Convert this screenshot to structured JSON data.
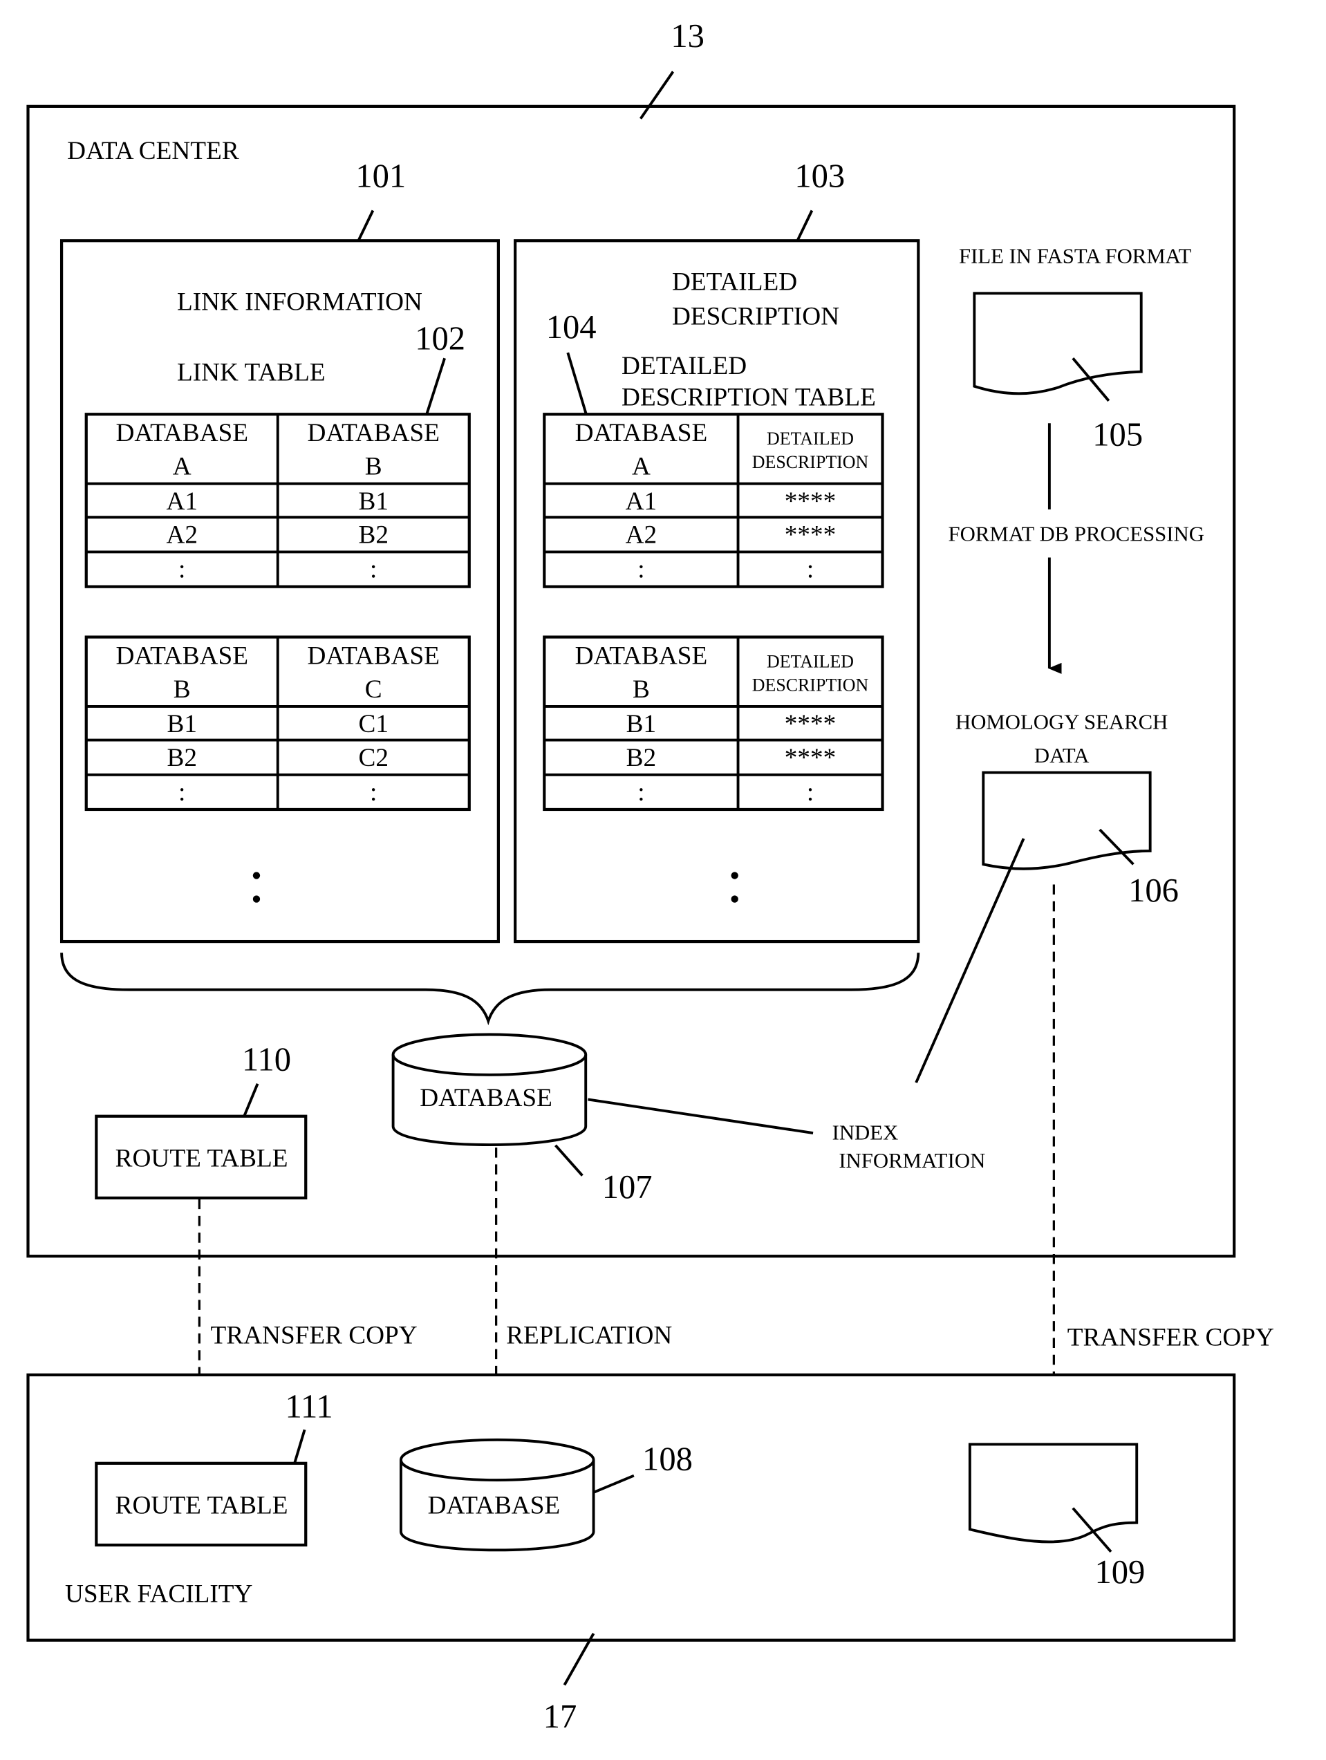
{
  "figure": {
    "refs": {
      "data_center": "13",
      "user_facility": "17",
      "link_information": "101",
      "link_table": "102",
      "detailed_description": "103",
      "detailed_description_table": "104",
      "fasta_file": "105",
      "homology_search_data": "106",
      "database_center": "107",
      "database_user": "108",
      "homology_copy": "109",
      "route_table_center": "110",
      "route_table_user": "111"
    },
    "data_center": {
      "title": "DATA CENTER",
      "link_information": {
        "title": "LINK INFORMATION",
        "subtitle": "LINK TABLE",
        "tables": [
          {
            "headers": [
              [
                "DATABASE",
                "A"
              ],
              [
                "DATABASE",
                "B"
              ]
            ],
            "rows": [
              [
                "A1",
                "B1"
              ],
              [
                "A2",
                "B2"
              ],
              [
                ":",
                ":"
              ]
            ]
          },
          {
            "headers": [
              [
                "DATABASE",
                "B"
              ],
              [
                "DATABASE",
                "C"
              ]
            ],
            "rows": [
              [
                "B1",
                "C1"
              ],
              [
                "B2",
                "C2"
              ],
              [
                ":",
                ":"
              ]
            ]
          }
        ],
        "ellipsis": ":"
      },
      "detailed_description": {
        "title_line1": "DETAILED",
        "title_line2": "DESCRIPTION",
        "subtitle_line1": "DETAILED",
        "subtitle_line2": "DESCRIPTION TABLE",
        "tables": [
          {
            "headers": [
              [
                "DATABASE",
                "A"
              ],
              [
                "DETAILED",
                "DESCRIPTION"
              ]
            ],
            "rows": [
              [
                "A1",
                "****"
              ],
              [
                "A2",
                "****"
              ],
              [
                ":",
                ":"
              ]
            ]
          },
          {
            "headers": [
              [
                "DATABASE",
                "B"
              ],
              [
                "DETAILED",
                "DESCRIPTION"
              ]
            ],
            "rows": [
              [
                "B1",
                "****"
              ],
              [
                "B2",
                "****"
              ],
              [
                ":",
                ":"
              ]
            ]
          }
        ],
        "ellipsis": ":"
      },
      "fasta_label": "FILE IN FASTA FORMAT",
      "format_processing_label": "FORMAT DB PROCESSING",
      "homology_label_line1": "HOMOLOGY SEARCH",
      "homology_label_line2": "DATA",
      "database_label": "DATABASE",
      "index_label_line1": "INDEX",
      "index_label_line2": "INFORMATION",
      "route_table_label": "ROUTE TABLE"
    },
    "transfers": {
      "route": "TRANSFER COPY",
      "database": "REPLICATION",
      "homology": "TRANSFER COPY"
    },
    "user_facility": {
      "title": "USER FACILITY",
      "route_table_label": "ROUTE TABLE",
      "database_label": "DATABASE"
    }
  }
}
